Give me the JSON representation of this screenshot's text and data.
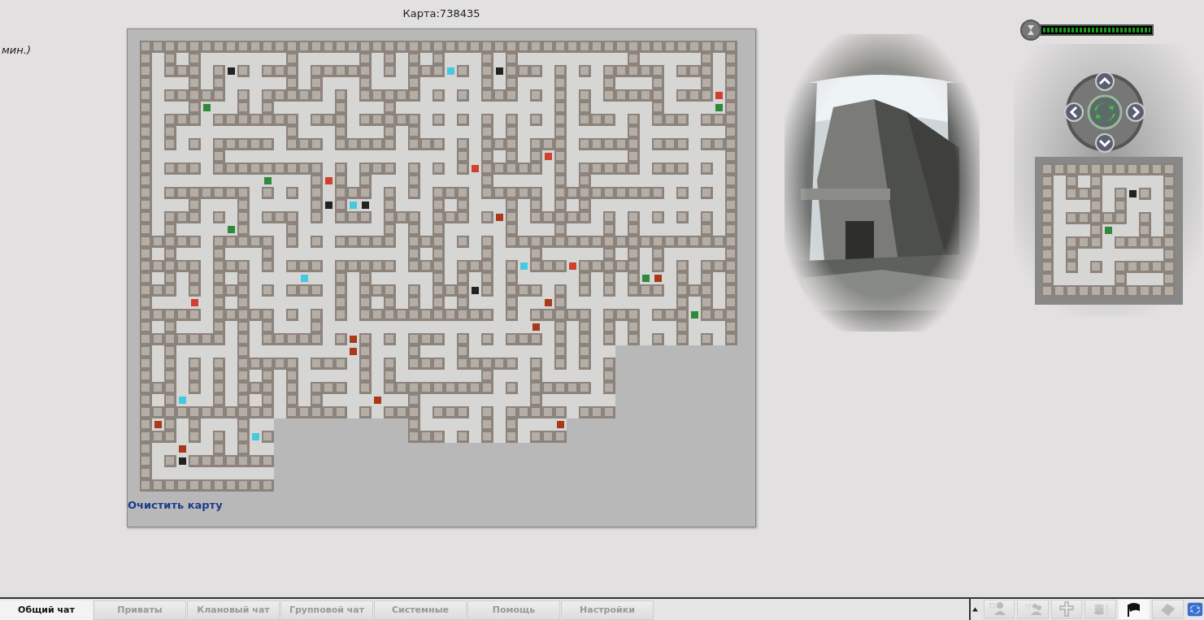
{
  "side_note": "мин.)",
  "map_title": "Карта:738435",
  "clear_map_link": "Очистить карту",
  "timer": {
    "level": 1
  },
  "chat_tabs": [
    {
      "label": "Общий чат",
      "selected": true
    },
    {
      "label": "Приваты",
      "selected": false
    },
    {
      "label": "Клановый чат",
      "selected": false
    },
    {
      "label": "Групповой чат",
      "selected": false
    },
    {
      "label": "Системные",
      "selected": false
    },
    {
      "label": "Помощь",
      "selected": false
    },
    {
      "label": "Настройки",
      "selected": false
    }
  ],
  "toolbar_icons": [
    {
      "kind": "user",
      "selected": false
    },
    {
      "kind": "people",
      "selected": false
    },
    {
      "kind": "cross",
      "selected": false
    },
    {
      "kind": "coins",
      "selected": false
    },
    {
      "kind": "flag",
      "selected": true
    },
    {
      "kind": "card",
      "selected": false
    },
    {
      "kind": "refresh",
      "selected": false
    }
  ]
}
